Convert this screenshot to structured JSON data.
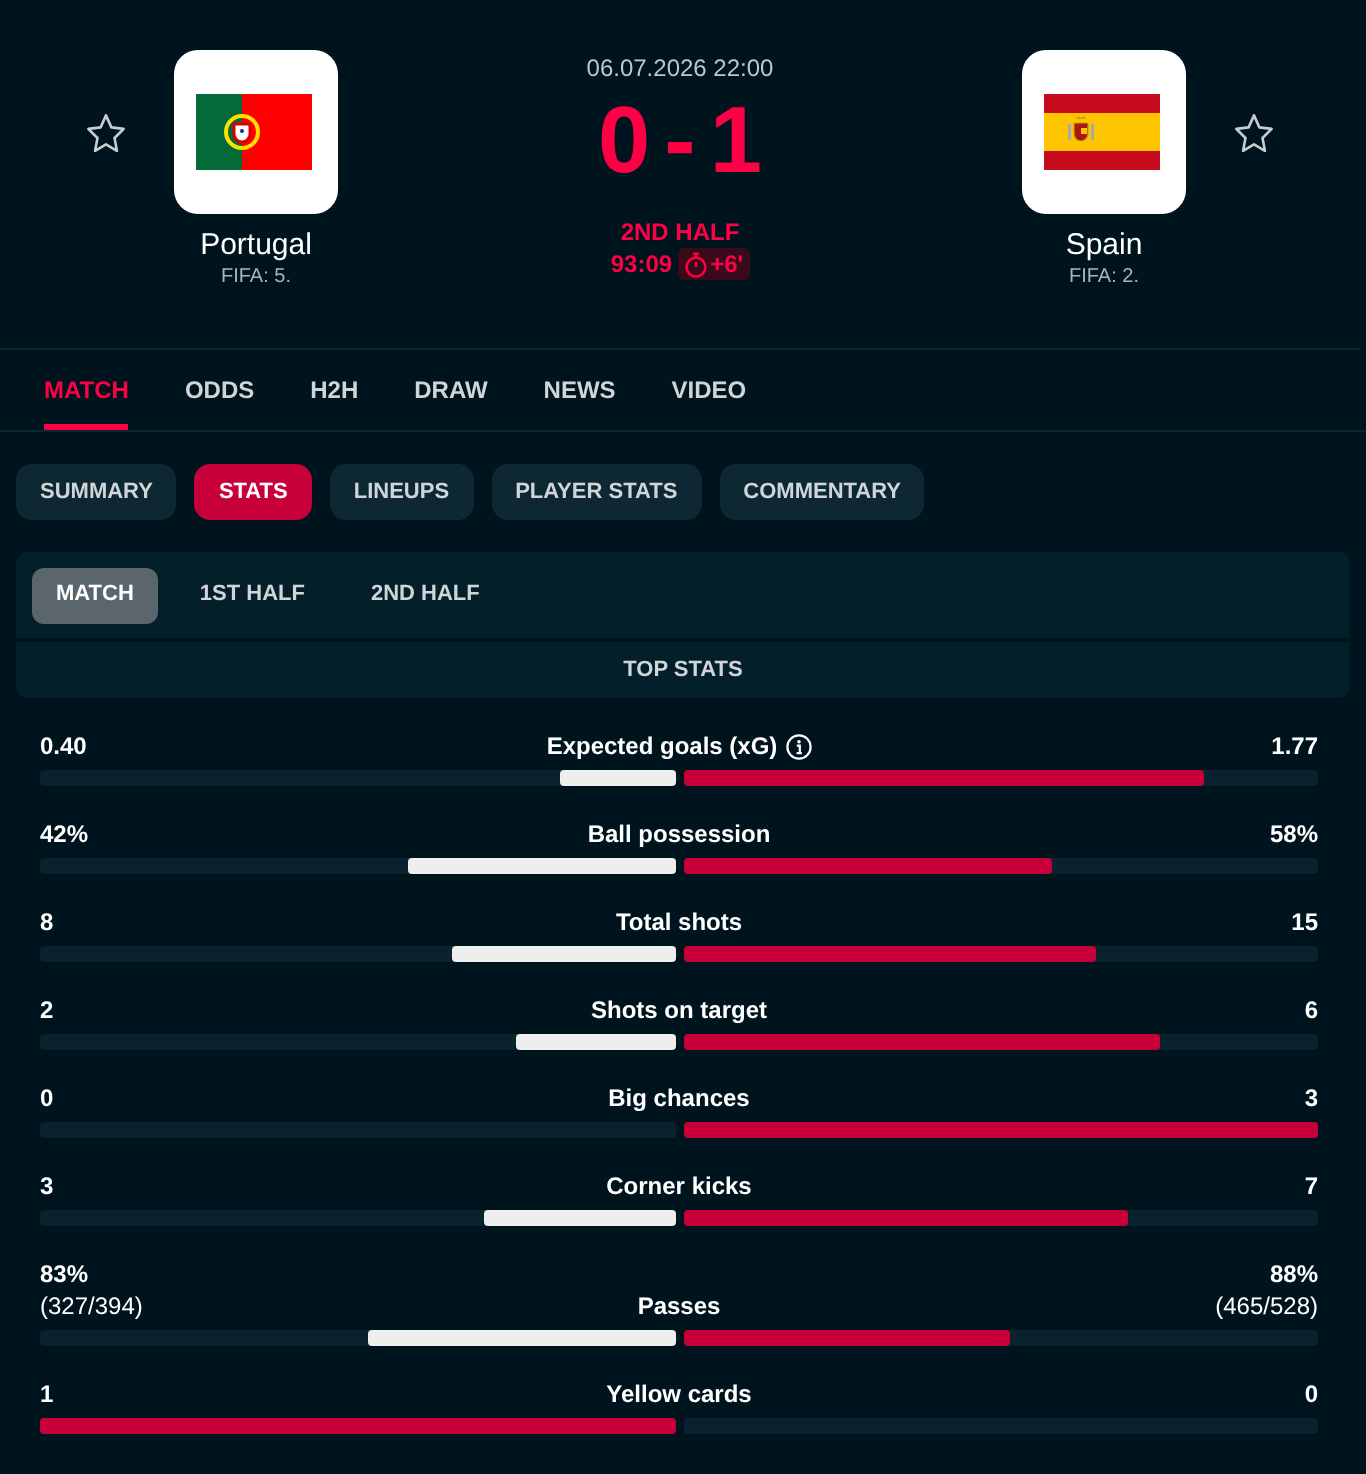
{
  "header": {
    "home": {
      "name": "Portugal",
      "ranking": "FIFA: 5.",
      "favorite": false
    },
    "away": {
      "name": "Spain",
      "ranking": "FIFA: 2.",
      "favorite": false
    },
    "date": "06.07.2026 22:00",
    "score": "0-1",
    "period": "2ND HALF",
    "clock": "93:09",
    "added_time": "+6'"
  },
  "tabs": [
    {
      "label": "MATCH",
      "selected": true
    },
    {
      "label": "ODDS",
      "selected": false
    },
    {
      "label": "H2H",
      "selected": false
    },
    {
      "label": "DRAW",
      "selected": false
    },
    {
      "label": "NEWS",
      "selected": false
    },
    {
      "label": "VIDEO",
      "selected": false
    }
  ],
  "sections": [
    {
      "label": "SUMMARY",
      "selected": false
    },
    {
      "label": "STATS",
      "selected": true
    },
    {
      "label": "LINEUPS",
      "selected": false
    },
    {
      "label": "PLAYER STATS",
      "selected": false
    },
    {
      "label": "COMMENTARY",
      "selected": false
    }
  ],
  "periods": [
    {
      "label": "MATCH",
      "selected": true
    },
    {
      "label": "1ST HALF",
      "selected": false
    },
    {
      "label": "2ND HALF",
      "selected": false
    }
  ],
  "stats": {
    "title": "TOP STATS",
    "rows": [
      {
        "label": "Expected goals (xG)",
        "info": true,
        "home": {
          "value": "0.40",
          "level": 0.18
        },
        "away": {
          "value": "1.77",
          "level": 0.82
        }
      },
      {
        "label": "Ball possession",
        "info": false,
        "home": {
          "value": "42%",
          "level": 0.42
        },
        "away": {
          "value": "58%",
          "level": 0.58
        }
      },
      {
        "label": "Total shots",
        "info": false,
        "home": {
          "value": "8",
          "level": 0.35
        },
        "away": {
          "value": "15",
          "level": 0.65
        }
      },
      {
        "label": "Shots on target",
        "info": false,
        "home": {
          "value": "2",
          "level": 0.25
        },
        "away": {
          "value": "6",
          "level": 0.75
        }
      },
      {
        "label": "Big chances",
        "info": false,
        "home": {
          "value": "0"
        },
        "away": {
          "value": "3",
          "level": 1
        }
      },
      {
        "label": "Corner kicks",
        "info": false,
        "home": {
          "value": "3",
          "level": 0.3
        },
        "away": {
          "value": "7",
          "level": 0.7
        }
      },
      {
        "label": "Passes",
        "info": false,
        "home": {
          "value": "83%",
          "detail": "(327/394)",
          "level": 0.485
        },
        "away": {
          "value": "88%",
          "detail": "(465/528)",
          "level": 0.515
        }
      },
      {
        "label": "Yellow cards",
        "info": false,
        "home": {
          "value": "1",
          "level": 1
        },
        "away": {
          "value": "0"
        }
      }
    ]
  }
}
